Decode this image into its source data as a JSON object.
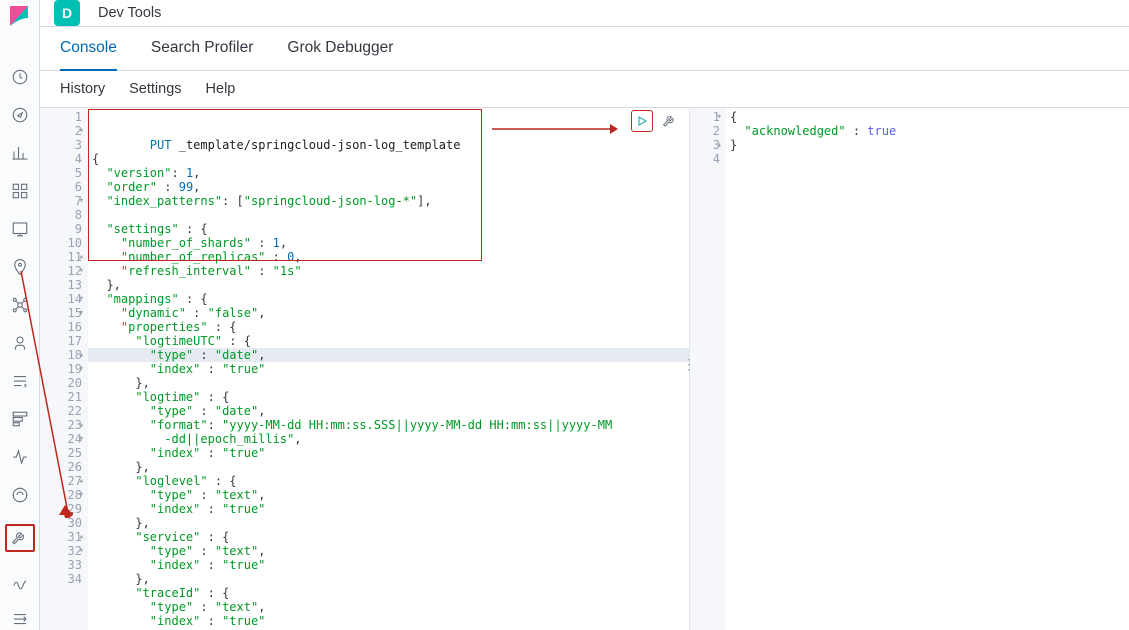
{
  "header": {
    "badge": "D",
    "title": "Dev Tools"
  },
  "tabs": [
    {
      "label": "Console",
      "active": true
    },
    {
      "label": "Search Profiler",
      "active": false
    },
    {
      "label": "Grok Debugger",
      "active": false
    }
  ],
  "subnav": [
    "History",
    "Settings",
    "Help"
  ],
  "editor_left": {
    "method": "PUT",
    "path": "_template/springcloud-json-log_template",
    "lines": [
      {
        "n": 1
      },
      {
        "n": 2,
        "fold": "▾"
      },
      {
        "n": 3
      },
      {
        "n": 4
      },
      {
        "n": 5
      },
      {
        "n": 6
      },
      {
        "n": 7,
        "fold": "▾"
      },
      {
        "n": 8
      },
      {
        "n": 9
      },
      {
        "n": 10
      },
      {
        "n": 11,
        "fold": "▴"
      },
      {
        "n": 12,
        "fold": "▾"
      },
      {
        "n": 13
      },
      {
        "n": 14,
        "fold": "▾"
      },
      {
        "n": 15,
        "fold": "▾"
      },
      {
        "n": 16
      },
      {
        "n": 17
      },
      {
        "n": 18,
        "fold": "▴"
      },
      {
        "n": 19,
        "fold": "▾"
      },
      {
        "n": 20
      },
      {
        "n": 21
      },
      {
        "n": 22
      },
      {
        "n": 23,
        "fold": "▴"
      },
      {
        "n": 24,
        "fold": "▾"
      },
      {
        "n": 25
      },
      {
        "n": 26
      },
      {
        "n": 27,
        "fold": "▴"
      },
      {
        "n": 28,
        "fold": "▾"
      },
      {
        "n": 29
      },
      {
        "n": 30
      },
      {
        "n": 31,
        "fold": "▴"
      },
      {
        "n": 32,
        "fold": "▾"
      },
      {
        "n": 33
      },
      {
        "n": 34
      }
    ],
    "body": {
      "version": 1,
      "order": 99,
      "index_patterns": [
        "springcloud-json-log-*"
      ],
      "settings": {
        "number_of_shards": 1,
        "number_of_replicas": 0,
        "refresh_interval": "1s"
      },
      "mappings": {
        "dynamic": "false",
        "properties": {
          "logtimeUTC": {
            "type": "date",
            "index": "true"
          },
          "logtime": {
            "type": "date",
            "format": "yyyy-MM-dd HH:mm:ss.SSS||yyyy-MM-dd HH:mm:ss||yyyy-MM-dd||epoch_millis",
            "index": "true"
          },
          "loglevel": {
            "type": "text",
            "index": "true"
          },
          "service": {
            "type": "text",
            "index": "true"
          },
          "traceId": {
            "type": "text",
            "index": "true"
          }
        }
      }
    }
  },
  "editor_right": {
    "lines": [
      {
        "n": 1,
        "fold": "▾"
      },
      {
        "n": 2
      },
      {
        "n": 3,
        "fold": "▴"
      },
      {
        "n": 4
      }
    ],
    "response": {
      "acknowledged": true
    }
  },
  "colors": {
    "accent": "#006bb4",
    "method": "#0079a5",
    "string": "#009926",
    "annotation": "#bd271e"
  }
}
